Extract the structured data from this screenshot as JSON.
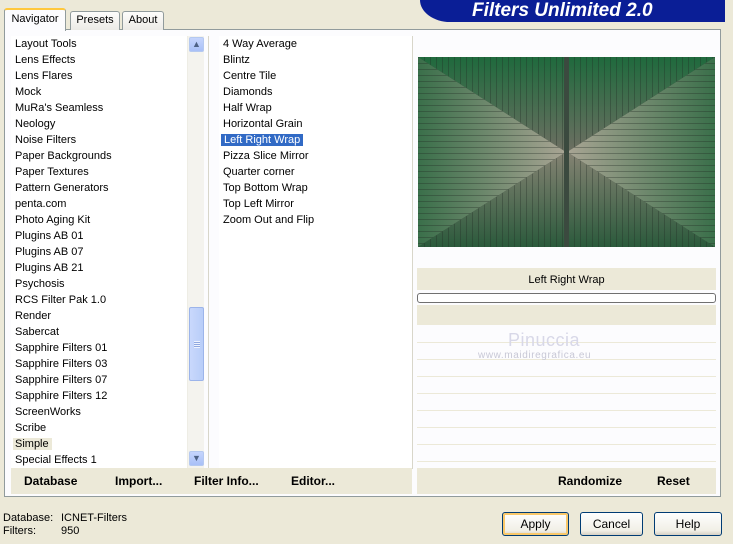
{
  "tabs": [
    {
      "label": "Navigator",
      "active": true
    },
    {
      "label": "Presets",
      "active": false
    },
    {
      "label": "About",
      "active": false
    }
  ],
  "banner_title": "Filters Unlimited 2.0",
  "categories": [
    "Layout Tools",
    "Lens Effects",
    "Lens Flares",
    "Mock",
    "MuRa's Seamless",
    "Neology",
    "Noise Filters",
    "Paper Backgrounds",
    "Paper Textures",
    "Pattern Generators",
    "penta.com",
    "Photo Aging Kit",
    "Plugins AB 01",
    "Plugins AB 07",
    "Plugins AB 21",
    "Psychosis",
    "RCS Filter Pak 1.0",
    "Render",
    "Sabercat",
    "Sapphire Filters 01",
    "Sapphire Filters 03",
    "Sapphire Filters 07",
    "Sapphire Filters 12",
    "ScreenWorks",
    "Scribe",
    "Simple",
    "Special Effects 1"
  ],
  "selected_category": "Simple",
  "filters": [
    "4 Way Average",
    "Blintz",
    "Centre Tile",
    "Diamonds",
    "Half Wrap",
    "Horizontal Grain",
    "Left Right Wrap",
    "Pizza Slice Mirror",
    "Quarter corner",
    "Top Bottom Wrap",
    "Top Left Mirror",
    "Zoom Out and Flip"
  ],
  "selected_filter": "Left Right Wrap",
  "filter_name": "Left Right Wrap",
  "progress": 0,
  "watermark": {
    "name": "Pinuccia",
    "url": "www.maidiregrafica.eu"
  },
  "left_buttons": {
    "database": "Database",
    "import": "Import...",
    "filter_info": "Filter Info...",
    "editor": "Editor..."
  },
  "right_buttons": {
    "randomize": "Randomize",
    "reset": "Reset"
  },
  "status": {
    "database_label": "Database:",
    "database_value": "ICNET-Filters",
    "filters_label": "Filters:",
    "filters_value": "950"
  },
  "dialog_buttons": {
    "apply": "Apply",
    "cancel": "Cancel",
    "help": "Help"
  },
  "colors": {
    "selection": "#316ac5",
    "banner": "#0a1e96",
    "dialog_bg": "#ece9d8"
  }
}
